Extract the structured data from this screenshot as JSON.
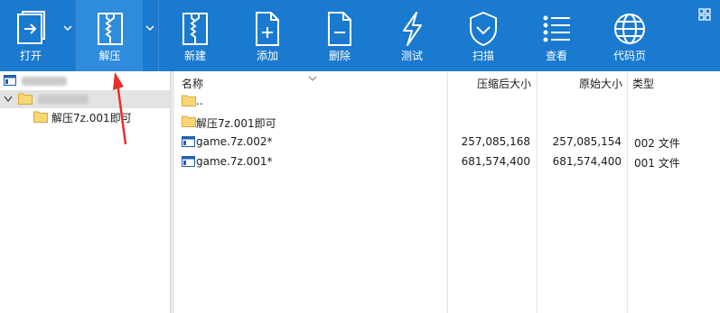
{
  "toolbar": {
    "buttons": [
      {
        "label": "打开",
        "icon": "open-icon"
      },
      {
        "label": "解压",
        "icon": "extract-icon"
      },
      {
        "label": "新建",
        "icon": "new-archive-icon"
      },
      {
        "label": "添加",
        "icon": "add-icon"
      },
      {
        "label": "删除",
        "icon": "delete-icon"
      },
      {
        "label": "测试",
        "icon": "test-icon"
      },
      {
        "label": "扫描",
        "icon": "scan-shield-icon"
      },
      {
        "label": "查看",
        "icon": "view-list-icon"
      },
      {
        "label": "代码页",
        "icon": "codepage-globe-icon"
      }
    ],
    "accent": "#1a7ad0",
    "active_bg": "#2f8bdb"
  },
  "tree": {
    "child_label": "解压7z.001即可"
  },
  "list": {
    "columns": [
      "名称",
      "压缩后大小",
      "原始大小",
      "类型"
    ],
    "rows": [
      {
        "name": "..",
        "packed": "",
        "size": "",
        "type": "",
        "icon": "folder-icon"
      },
      {
        "name": "解压7z.001即可",
        "packed": "",
        "size": "",
        "type": "",
        "icon": "folder-icon"
      },
      {
        "name": "game.7z.002*",
        "packed": "257,085,168",
        "size": "257,085,154",
        "type": "002 文件",
        "icon": "file-icon"
      },
      {
        "name": "game.7z.001*",
        "packed": "681,574,400",
        "size": "681,574,400",
        "type": "001 文件",
        "icon": "file-icon"
      }
    ]
  },
  "annotation_color": "#e8302a"
}
